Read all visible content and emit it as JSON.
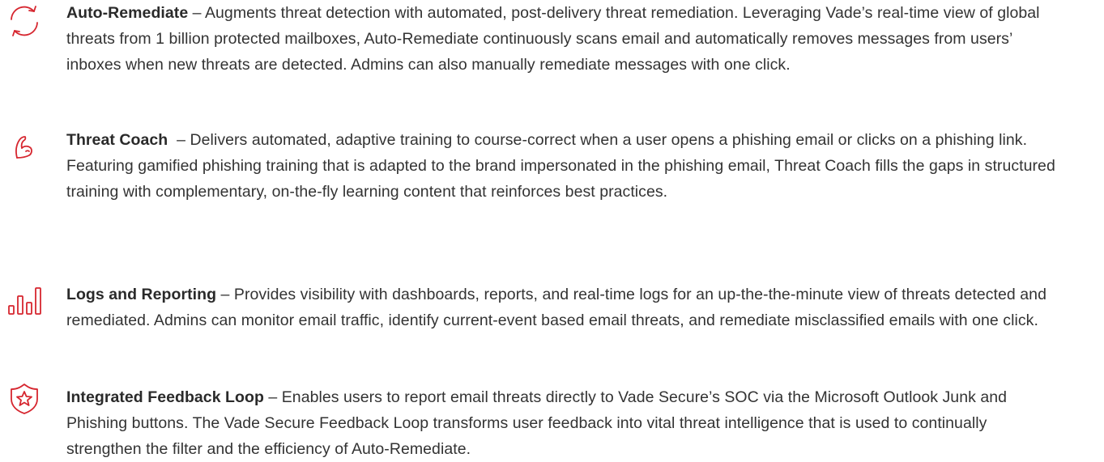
{
  "colors": {
    "accent": "#d6262f",
    "text": "#333333"
  },
  "features": [
    {
      "icon": "refresh-icon",
      "title": "Auto-Remediate",
      "separator": " – ",
      "description": "Augments threat detection with automated, post-delivery threat remediation. Leveraging Vade’s real-time view of global threats from 1 billion protected mailboxes, Auto-Remediate continuously scans email and automatically removes messages from users’ inboxes when new threats are detected. Admins can also manually remediate messages with one click."
    },
    {
      "icon": "flexed-arm-icon",
      "title": "Threat Coach",
      "separator": "  – ",
      "description": "Delivers automated, adaptive training to course-correct when a user opens a phishing email or clicks on a phishing link. Featuring gamified phishing training that is adapted to the brand impersonated in the phishing email, Threat Coach fills the gaps in structured training with complementary, on-the-fly learning content that reinforces best practices."
    },
    {
      "icon": "bar-chart-icon",
      "title": "Logs and Reporting",
      "separator": " – ",
      "description": "Provides visibility with dashboards, reports, and real-time logs for an up-the-the-minute view of threats detected and remediated. Admins can monitor email traffic, identify current-event based email threats, and remediate misclassified emails with one click."
    },
    {
      "icon": "shield-star-icon",
      "title": "Integrated Feedback Loop",
      "separator": " – ",
      "description": "Enables users to report email threats directly to Vade Secure’s SOC via the Microsoft Outlook Junk and Phishing buttons. The Vade Secure Feedback Loop transforms user feedback into vital threat intelligence that is used to continually strengthen the filter and the efficiency of Auto-Remediate."
    }
  ]
}
